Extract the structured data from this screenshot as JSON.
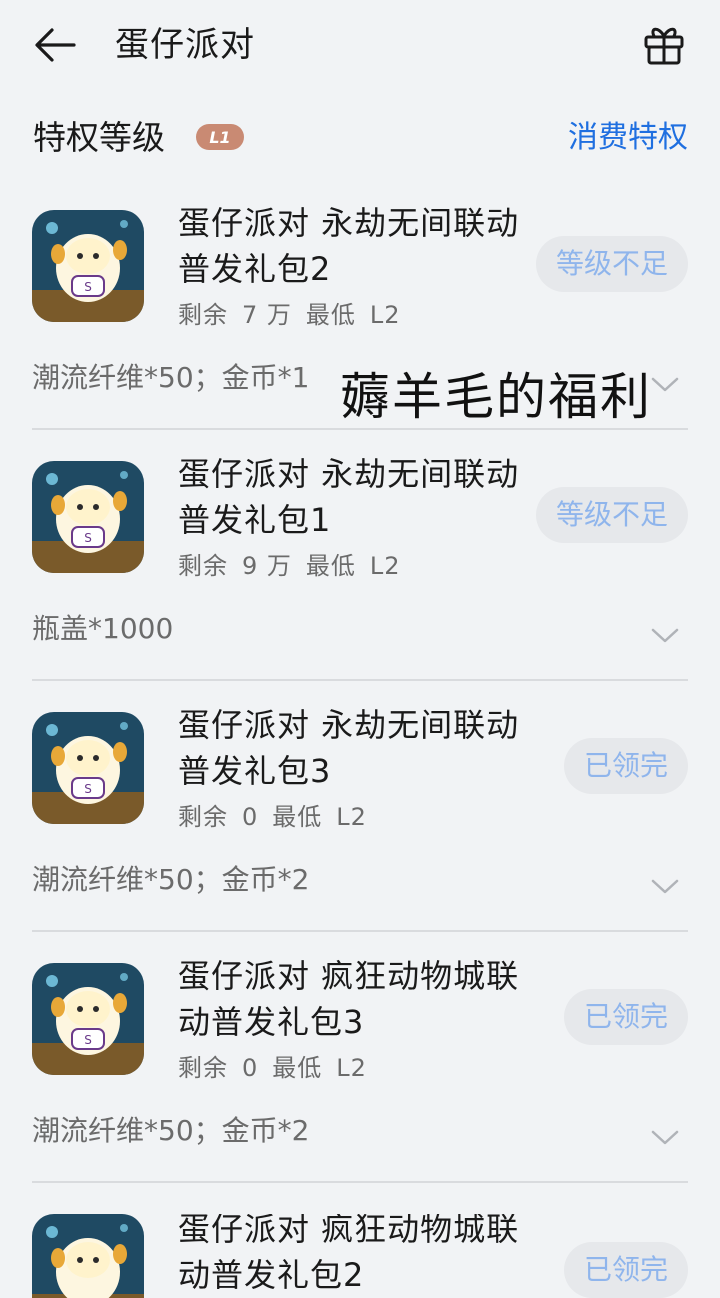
{
  "header": {
    "title": "蛋仔派对",
    "back_icon": "arrow-left-icon",
    "gift_icon": "gift-icon"
  },
  "privilege": {
    "label": "特权等级",
    "level_badge": "L1",
    "link": "消费特权"
  },
  "colors": {
    "background": "#f1f3f5",
    "link_blue": "#1f6fe0",
    "badge_bg": "#c98a73",
    "disabled_btn_text": "#8fb5ec"
  },
  "items": [
    {
      "title": "蛋仔派对 永劫无间联动普发礼包2",
      "remain_label": "剩余",
      "remain_value": "7 万",
      "min_label": "最低",
      "min_value": "L2",
      "action": "等级不足",
      "reward": "潮流纤维*50；金币*1"
    },
    {
      "title": "蛋仔派对 永劫无间联动普发礼包1",
      "remain_label": "剩余",
      "remain_value": "9 万",
      "min_label": "最低",
      "min_value": "L2",
      "action": "等级不足",
      "reward": "瓶盖*1000"
    },
    {
      "title": "蛋仔派对 永劫无间联动普发礼包3",
      "remain_label": "剩余",
      "remain_value": "0",
      "min_label": "最低",
      "min_value": "L2",
      "action": "已领完",
      "reward": "潮流纤维*50；金币*2"
    },
    {
      "title": "蛋仔派对 疯狂动物城联动普发礼包3",
      "remain_label": "剩余",
      "remain_value": "0",
      "min_label": "最低",
      "min_value": "L2",
      "action": "已领完",
      "reward": "潮流纤维*50；金币*2"
    },
    {
      "title": "蛋仔派对 疯狂动物城联动普发礼包2",
      "remain_label": "剩余",
      "remain_value": "",
      "min_label": "",
      "min_value": "",
      "action": "已领完",
      "reward": ""
    }
  ],
  "watermark": "薅羊毛的福利"
}
